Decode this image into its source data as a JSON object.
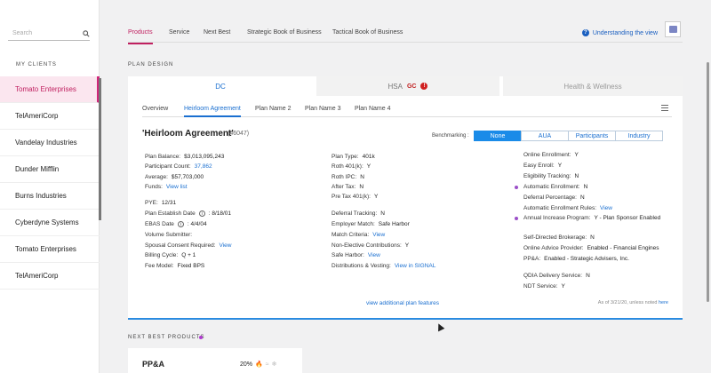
{
  "sidebar": {
    "search_placeholder": "Search",
    "section_title": "MY CLIENTS",
    "clients": [
      "Tomato Enterprises",
      "TelAmeriCorp",
      "Vandelay Industries",
      "Dunder Mifflin",
      "Burns Industries",
      "Cyberdyne Systems",
      "Tomato Enterprises",
      "TelAmeriCorp"
    ]
  },
  "topnav": {
    "tabs": [
      "Products",
      "Service",
      "Next Best",
      "Strategic Book of Business",
      "Tactical Book of Business"
    ],
    "understanding": "Understanding the view",
    "help_glyph": "?"
  },
  "plan_design": {
    "section_title": "PLAN DESIGN",
    "tabs": {
      "dc": "DC",
      "hsa": "HSA",
      "hsa_badge": "GC",
      "hsa_alert": "!",
      "hw": "Health & Wellness"
    },
    "subtabs": [
      "Overview",
      "Heirloom Agreement",
      "Plan Name 2",
      "Plan Name 3",
      "Plan Name 4"
    ],
    "plan_title": "'Heirloom Agreement'",
    "plan_id": "(46047)",
    "benchmarking_label": "Benchmarking :",
    "benchmarks": [
      "None",
      "AUA",
      "Participants",
      "Industry"
    ],
    "col1": {
      "plan_balance_label": "Plan Balance:",
      "plan_balance": "$3,013,095,243",
      "participant_count_label": "Participant Count:",
      "participant_count": "37,862",
      "average_label": "Average:",
      "average": "$57,703,000",
      "funds_label": "Funds:",
      "funds_link": "View list",
      "pye_label": "PYE:",
      "pye": "12/31",
      "establish_label": "Plan Establish Date",
      "establish": ": 8/18/01",
      "ebas_label": "EBAS Date",
      "ebas": ": 4/4/04",
      "volume_label": "Volume Submitter:",
      "spousal_label": "Spousal Consent Required:",
      "spousal_link": "View",
      "billing_label": "Billing Cycle:",
      "billing": "Q + 1",
      "fee_label": "Fee Model:",
      "fee": "Fixed BPS"
    },
    "col2": {
      "plan_type_label": "Plan Type:",
      "plan_type": "401k",
      "roth401_label": "Roth 401(k):",
      "roth401": "Y",
      "rothipc_label": "Roth IPC:",
      "rothipc": "N",
      "aftertax_label": "After Tax:",
      "aftertax": "N",
      "pretax_label": "Pre Tax 401(k):",
      "pretax": "Y",
      "deferral_tracking_label": "Deferral Tracking:",
      "deferral_tracking": "N",
      "employer_match_label": "Employer Match:",
      "employer_match": "Safe Harbor",
      "match_criteria_label": "Match Criteria:",
      "match_criteria_link": "View",
      "nonelective_label": "Non-Elective Contributions:",
      "nonelective": "Y",
      "safeharbor_label": "Safe Harbor:",
      "safeharbor_link": "View",
      "distributions_label": "Distributions & Vesting:",
      "distributions_link": "View in SIGNAL"
    },
    "col3": {
      "online_enroll_label": "Online Enrollment:",
      "online_enroll": "Y",
      "easy_enroll_label": "Easy Enroll:",
      "easy_enroll": "Y",
      "elig_label": "Eligibility Tracking:",
      "elig": "N",
      "auto_enroll_label": "Automatic Enrollment:",
      "auto_enroll": "N",
      "deferral_pct_label": "Deferral Percentage:",
      "deferral_pct": "N",
      "auto_rules_label": "Automatic Enrollment Rules:",
      "auto_rules_link": "View",
      "annual_label": "Annual Increase Program:",
      "annual": "Y - Plan Sponsor Enabled",
      "sdb_label": "Self-Directed Brokerage:",
      "sdb": "N",
      "oap_label": "Online Advice Provider:",
      "oap": "Enabled - Financial Engines",
      "ppa_label": "PP&A:",
      "ppa": "Enabled - Strategic Advisers, Inc.",
      "qdia_label": "QDIA Delivery Service:",
      "qdia": "N",
      "ndt_label": "NDT Service:",
      "ndt": "Y"
    },
    "view_more": "view additional plan features",
    "asof": "As of 3/21/20, unless noted",
    "asof_link": "here"
  },
  "next_best": {
    "section_title": "NEXT BEST PRODUCTS",
    "card_title": "PP&A",
    "pct": "20%"
  }
}
